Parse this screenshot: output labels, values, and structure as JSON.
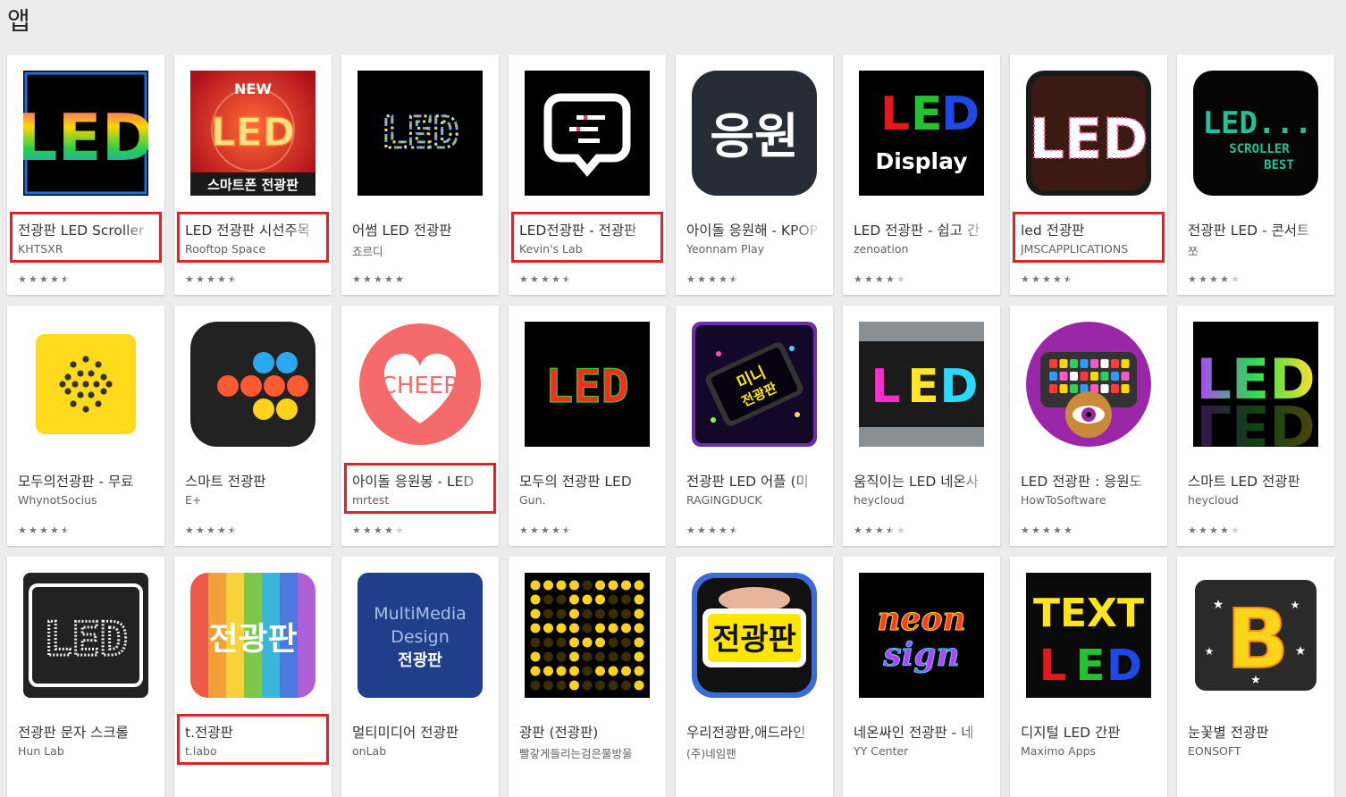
{
  "page": {
    "title": "앱"
  },
  "apps": [
    {
      "title": "전광판 LED Scroller",
      "developer": "KHTSXR",
      "rating": 4.5,
      "highlighted": true,
      "icon": "led-rainbow-icon"
    },
    {
      "title": "LED 전광판 시선주목",
      "developer": "Rooftop Space",
      "rating": 4.5,
      "highlighted": true,
      "icon": "new-led-smartphone-icon"
    },
    {
      "title": "어썸 LED 전광판",
      "developer": "죠르디",
      "rating": 5,
      "highlighted": false,
      "icon": "dot-led-icon"
    },
    {
      "title": "LED전광판 - 전광판",
      "developer": "Kevin's Lab",
      "rating": 4.5,
      "highlighted": true,
      "icon": "speech-bubble-icon"
    },
    {
      "title": "아이돌 응원해 - KPOP",
      "developer": "Yeonnam Play",
      "rating": 4.5,
      "highlighted": false,
      "icon": "cheer-korean-icon"
    },
    {
      "title": "LED 전광판 - 쉽고 간",
      "developer": "zenoation",
      "rating": 4,
      "highlighted": false,
      "icon": "led-display-icon"
    },
    {
      "title": "led 전광판",
      "developer": "JMSCAPPLICATIONS",
      "rating": 4.5,
      "highlighted": true,
      "icon": "led-dots-icon"
    },
    {
      "title": "전광판 LED - 콘서트",
      "developer": "쪼",
      "rating": 4,
      "highlighted": false,
      "icon": "led-scroller-best-icon"
    },
    {
      "title": "모두의전광판 - 무료",
      "developer": "WhynotSocius",
      "rating": 4.5,
      "highlighted": false,
      "icon": "yellow-dots-icon"
    },
    {
      "title": "스마트 전광판",
      "developer": "E+",
      "rating": 4.5,
      "highlighted": false,
      "icon": "color-circles-icon"
    },
    {
      "title": "아이돌 응원봉 - LED",
      "developer": "mrtest",
      "rating": 4,
      "highlighted": true,
      "icon": "cheer-heart-icon"
    },
    {
      "title": "모두의 전광판 LED",
      "developer": "Gun.",
      "rating": 4.5,
      "highlighted": false,
      "icon": "red-led-icon"
    },
    {
      "title": "전광판 LED 어플 (미",
      "developer": "RAGINGDUCK",
      "rating": 4.5,
      "highlighted": false,
      "icon": "mini-phone-icon"
    },
    {
      "title": "움직이는 LED 네온사",
      "developer": "heycloud",
      "rating": 3.5,
      "highlighted": false,
      "icon": "neon-led-icon"
    },
    {
      "title": "LED 전광판 : 응원도",
      "developer": "HowToSoftware",
      "rating": 5,
      "highlighted": false,
      "icon": "eye-phone-icon"
    },
    {
      "title": "스마트 LED 전광판",
      "developer": "heycloud",
      "rating": 4,
      "highlighted": false,
      "icon": "led-reflect-icon"
    },
    {
      "title": "전광판 문자 스크롤",
      "developer": "Hun Lab",
      "rating": null,
      "highlighted": false,
      "icon": "led-frame-icon"
    },
    {
      "title": "t.전광판",
      "developer": "t.labo",
      "rating": null,
      "highlighted": true,
      "icon": "rainbow-stripes-icon"
    },
    {
      "title": "멀티미디어 전광판",
      "developer": "onLab",
      "rating": null,
      "highlighted": false,
      "icon": "multimedia-design-icon"
    },
    {
      "title": "광판 (전광판)",
      "developer": "빨갛게들리는검은물방울",
      "rating": null,
      "highlighted": false,
      "icon": "yellow-matrix-icon"
    },
    {
      "title": "우리전광판,애드라인",
      "developer": "(주)네임팬",
      "rating": null,
      "highlighted": false,
      "icon": "hand-phone-icon"
    },
    {
      "title": "네온싸인 전광판 - 네",
      "developer": "YY Center",
      "rating": null,
      "highlighted": false,
      "icon": "neon-sign-icon"
    },
    {
      "title": "디지털 LED 간판",
      "developer": "Maximo Apps",
      "rating": null,
      "highlighted": false,
      "icon": "text-led-icon"
    },
    {
      "title": "눈꽃별 전광판",
      "developer": "EONSOFT",
      "rating": null,
      "highlighted": false,
      "icon": "star-b-icon"
    }
  ],
  "icon_text": {
    "new": "NEW",
    "led": "LED",
    "smartphone": "스마트폰 전광판",
    "cheer_ko": "응원",
    "display": "Display",
    "led_dots": "LED...",
    "scroller": "SCROLLER",
    "best": "BEST",
    "cheer": "CHEER",
    "mini": "미니",
    "jeongwangpan": "전광판",
    "multimedia": "MultiMedia",
    "design": "Design",
    "neon": "neon",
    "sign": "sign",
    "text": "TEXT",
    "b": "B"
  },
  "colors": {
    "highlight": "#d9262b",
    "background": "#ececec",
    "card": "#ffffff"
  }
}
